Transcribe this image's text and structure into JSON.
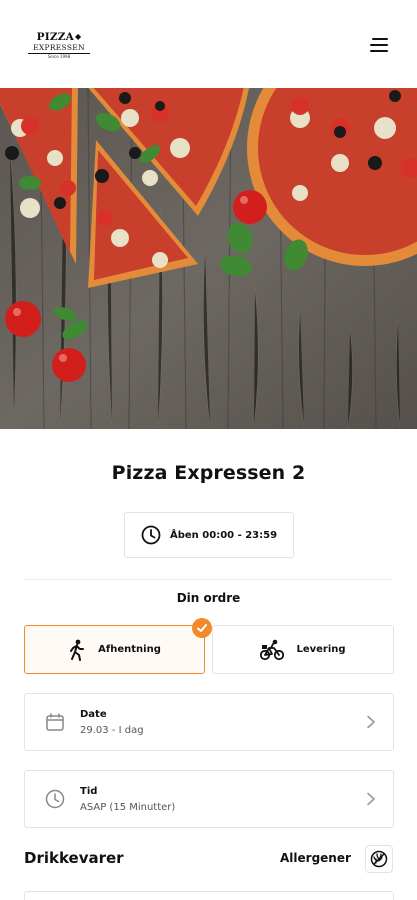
{
  "header": {
    "logo": {
      "line1": "PIZZA",
      "line2": "EXPRESSEN",
      "line3": "Since 1998"
    },
    "menu_icon": "hamburger-menu-icon"
  },
  "hero": {
    "icon": "pizza-photo"
  },
  "store": {
    "name": "Pizza Expressen 2"
  },
  "hours": {
    "label": "Åben 00:00 - 23:59",
    "icon": "clock-icon"
  },
  "order": {
    "title": "Din ordre",
    "options": [
      {
        "label": "Afhentning",
        "icon": "walking-person-icon",
        "selected": true
      },
      {
        "label": "Levering",
        "icon": "bicycle-courier-icon",
        "selected": false
      }
    ]
  },
  "date": {
    "title": "Date",
    "value": "29.03 - I dag",
    "icon": "calendar-icon"
  },
  "time": {
    "title": "Tid",
    "value": "ASAP (15 Minutter)",
    "icon": "clock-icon"
  },
  "drinks": {
    "title": "Drikkevarer"
  },
  "allergens": {
    "label": "Allergener",
    "icon": "wheat-allergen-icon"
  },
  "colors": {
    "accent": "#f28a2c",
    "border": "#e3e3e3",
    "text": "#111111"
  }
}
